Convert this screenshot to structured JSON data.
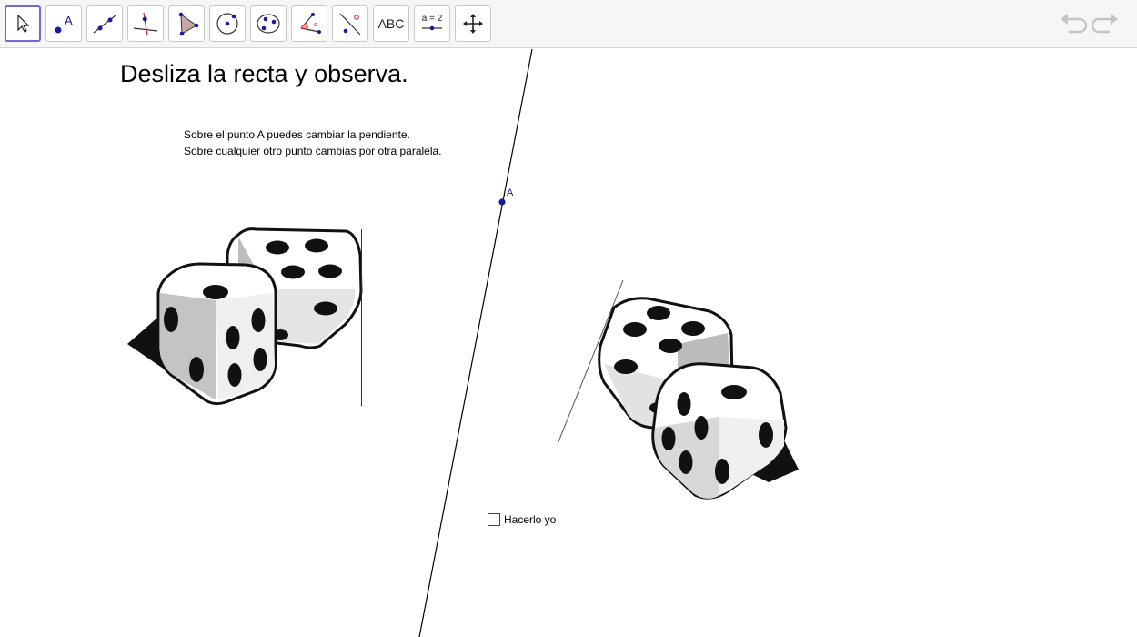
{
  "toolbar": {
    "tools": [
      {
        "name": "move",
        "label": ""
      },
      {
        "name": "point",
        "label": "A"
      },
      {
        "name": "line",
        "label": ""
      },
      {
        "name": "perpendicular-line",
        "label": ""
      },
      {
        "name": "polygon",
        "label": ""
      },
      {
        "name": "circle",
        "label": ""
      },
      {
        "name": "conic",
        "label": ""
      },
      {
        "name": "angle",
        "label": ""
      },
      {
        "name": "reflect",
        "label": ""
      },
      {
        "name": "text",
        "label": "ABC"
      },
      {
        "name": "slider",
        "label": "a = 2"
      },
      {
        "name": "move-graphics",
        "label": ""
      }
    ],
    "selected_tool": "move",
    "accent_color": "#6a6ad8"
  },
  "canvas": {
    "title": "Desliza la recta y observa.",
    "instructions": [
      "Sobre el punto A puedes cambiar la pendiente.",
      "Sobre cualquier otro punto cambias por otra paralela."
    ],
    "point_label": "A",
    "checkbox": {
      "label": "Hacerlo yo",
      "checked": false
    },
    "point_color": "#1a1aa0"
  }
}
